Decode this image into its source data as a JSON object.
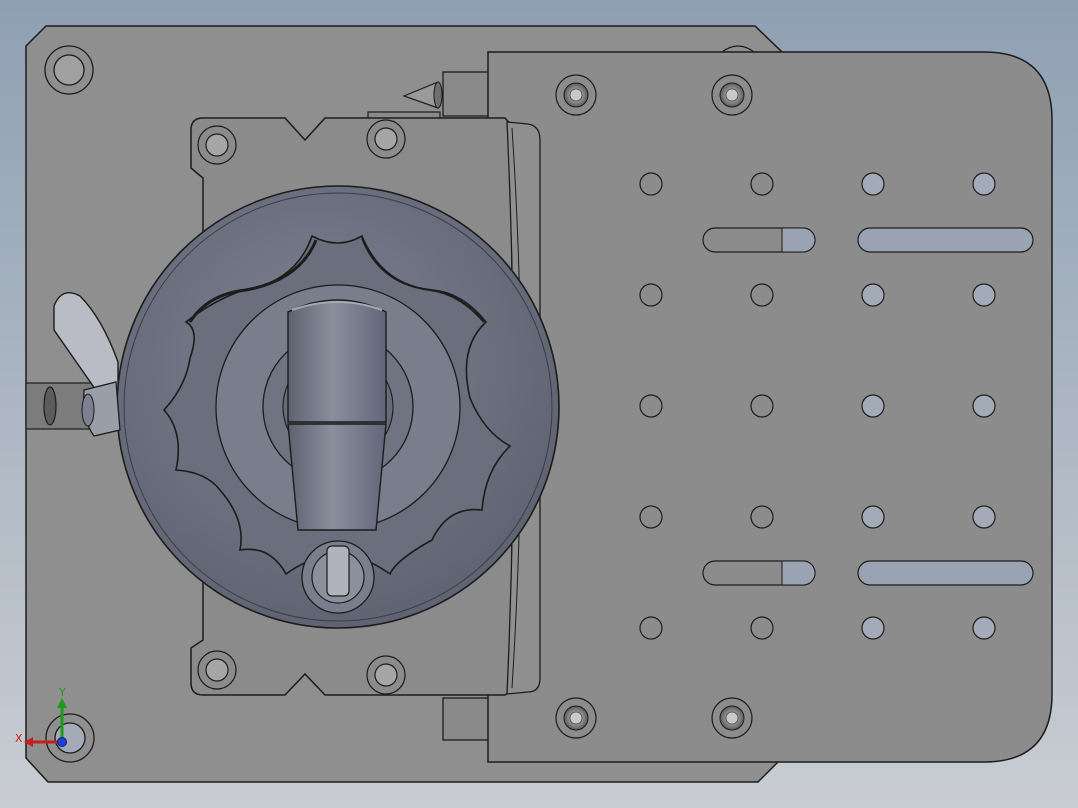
{
  "viewport": {
    "background_top": "#8fa0b3",
    "background_bottom": "#c9cdd3"
  },
  "model": {
    "base_plate_color": "#8f8f8f",
    "mount_plate_color": "#8c8c8c",
    "dial_color": "#6d7180",
    "dial_inner_color": "#7a7e8c",
    "outline_color": "#1c1c1c",
    "through_hole_color": "#a3abb8",
    "slot_color": "#9aa3b2",
    "handle_color": "#727684"
  },
  "triad": {
    "x_label": "X",
    "y_label": "Y",
    "x_color": "#c81e1e",
    "y_color": "#1d9a1d",
    "z_color": "#1f3fd8"
  }
}
